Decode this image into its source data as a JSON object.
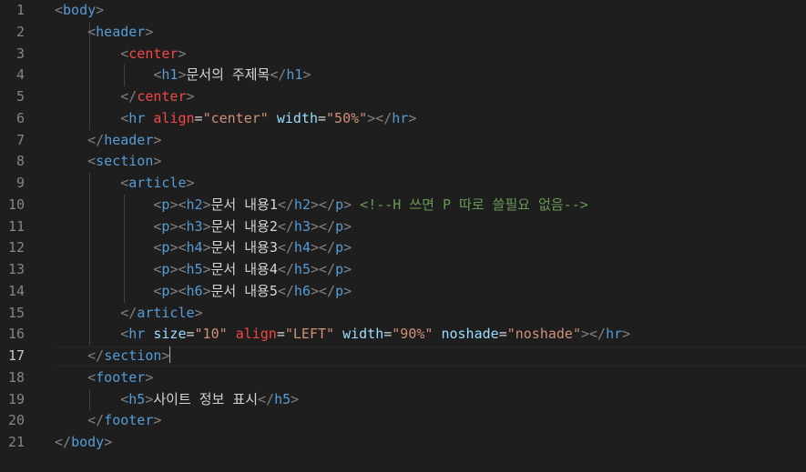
{
  "editor": {
    "active_line": 17,
    "lines": [
      {
        "num": "1",
        "tokens": [
          {
            "c": "t-punc",
            "t": "<"
          },
          {
            "c": "t-tag",
            "t": "body"
          },
          {
            "c": "t-punc",
            "t": ">"
          }
        ]
      },
      {
        "num": "2",
        "tokens": [
          {
            "c": "t-text",
            "t": "    "
          },
          {
            "c": "t-punc",
            "t": "<"
          },
          {
            "c": "t-tag",
            "t": "header"
          },
          {
            "c": "t-punc",
            "t": ">"
          }
        ]
      },
      {
        "num": "3",
        "tokens": [
          {
            "c": "t-text",
            "t": "        "
          },
          {
            "c": "t-punc",
            "t": "<"
          },
          {
            "c": "t-tag-red",
            "t": "center"
          },
          {
            "c": "t-punc",
            "t": ">"
          }
        ]
      },
      {
        "num": "4",
        "tokens": [
          {
            "c": "t-text",
            "t": "            "
          },
          {
            "c": "t-punc",
            "t": "<"
          },
          {
            "c": "t-tag",
            "t": "h1"
          },
          {
            "c": "t-punc",
            "t": ">"
          },
          {
            "c": "t-text",
            "t": "문서의 주제목"
          },
          {
            "c": "t-punc",
            "t": "</"
          },
          {
            "c": "t-tag",
            "t": "h1"
          },
          {
            "c": "t-punc",
            "t": ">"
          }
        ]
      },
      {
        "num": "5",
        "tokens": [
          {
            "c": "t-text",
            "t": "        "
          },
          {
            "c": "t-punc",
            "t": "</"
          },
          {
            "c": "t-tag-red",
            "t": "center"
          },
          {
            "c": "t-punc",
            "t": ">"
          }
        ]
      },
      {
        "num": "6",
        "tokens": [
          {
            "c": "t-text",
            "t": "        "
          },
          {
            "c": "t-punc",
            "t": "<"
          },
          {
            "c": "t-tag",
            "t": "hr"
          },
          {
            "c": "t-text",
            "t": " "
          },
          {
            "c": "t-tag-red",
            "t": "align"
          },
          {
            "c": "t-text",
            "t": "="
          },
          {
            "c": "t-str",
            "t": "\"center\""
          },
          {
            "c": "t-text",
            "t": " "
          },
          {
            "c": "t-attr",
            "t": "width"
          },
          {
            "c": "t-text",
            "t": "="
          },
          {
            "c": "t-str",
            "t": "\"50%\""
          },
          {
            "c": "t-punc",
            "t": "></"
          },
          {
            "c": "t-tag",
            "t": "hr"
          },
          {
            "c": "t-punc",
            "t": ">"
          }
        ]
      },
      {
        "num": "7",
        "tokens": [
          {
            "c": "t-text",
            "t": "    "
          },
          {
            "c": "t-punc",
            "t": "</"
          },
          {
            "c": "t-tag",
            "t": "header"
          },
          {
            "c": "t-punc",
            "t": ">"
          }
        ]
      },
      {
        "num": "8",
        "tokens": [
          {
            "c": "t-text",
            "t": "    "
          },
          {
            "c": "t-punc",
            "t": "<"
          },
          {
            "c": "t-tag",
            "t": "section"
          },
          {
            "c": "t-punc",
            "t": ">"
          }
        ]
      },
      {
        "num": "9",
        "tokens": [
          {
            "c": "t-text",
            "t": "        "
          },
          {
            "c": "t-punc",
            "t": "<"
          },
          {
            "c": "t-tag",
            "t": "article"
          },
          {
            "c": "t-punc",
            "t": ">"
          }
        ]
      },
      {
        "num": "10",
        "tokens": [
          {
            "c": "t-text",
            "t": "            "
          },
          {
            "c": "t-punc",
            "t": "<"
          },
          {
            "c": "t-tag",
            "t": "p"
          },
          {
            "c": "t-punc",
            "t": "><"
          },
          {
            "c": "t-tag",
            "t": "h2"
          },
          {
            "c": "t-punc",
            "t": ">"
          },
          {
            "c": "t-text",
            "t": "문서 내용1"
          },
          {
            "c": "t-punc",
            "t": "</"
          },
          {
            "c": "t-tag",
            "t": "h2"
          },
          {
            "c": "t-punc",
            "t": "></"
          },
          {
            "c": "t-tag",
            "t": "p"
          },
          {
            "c": "t-punc",
            "t": ">"
          },
          {
            "c": "t-text",
            "t": " "
          },
          {
            "c": "t-comment",
            "t": "<!--H 쓰면 P 따로 쓸필요 없음-->"
          }
        ]
      },
      {
        "num": "11",
        "tokens": [
          {
            "c": "t-text",
            "t": "            "
          },
          {
            "c": "t-punc",
            "t": "<"
          },
          {
            "c": "t-tag",
            "t": "p"
          },
          {
            "c": "t-punc",
            "t": "><"
          },
          {
            "c": "t-tag",
            "t": "h3"
          },
          {
            "c": "t-punc",
            "t": ">"
          },
          {
            "c": "t-text",
            "t": "문서 내용2"
          },
          {
            "c": "t-punc",
            "t": "</"
          },
          {
            "c": "t-tag",
            "t": "h3"
          },
          {
            "c": "t-punc",
            "t": "></"
          },
          {
            "c": "t-tag",
            "t": "p"
          },
          {
            "c": "t-punc",
            "t": ">"
          }
        ]
      },
      {
        "num": "12",
        "tokens": [
          {
            "c": "t-text",
            "t": "            "
          },
          {
            "c": "t-punc",
            "t": "<"
          },
          {
            "c": "t-tag",
            "t": "p"
          },
          {
            "c": "t-punc",
            "t": "><"
          },
          {
            "c": "t-tag",
            "t": "h4"
          },
          {
            "c": "t-punc",
            "t": ">"
          },
          {
            "c": "t-text",
            "t": "문서 내용3"
          },
          {
            "c": "t-punc",
            "t": "</"
          },
          {
            "c": "t-tag",
            "t": "h4"
          },
          {
            "c": "t-punc",
            "t": "></"
          },
          {
            "c": "t-tag",
            "t": "p"
          },
          {
            "c": "t-punc",
            "t": ">"
          }
        ]
      },
      {
        "num": "13",
        "tokens": [
          {
            "c": "t-text",
            "t": "            "
          },
          {
            "c": "t-punc",
            "t": "<"
          },
          {
            "c": "t-tag",
            "t": "p"
          },
          {
            "c": "t-punc",
            "t": "><"
          },
          {
            "c": "t-tag",
            "t": "h5"
          },
          {
            "c": "t-punc",
            "t": ">"
          },
          {
            "c": "t-text",
            "t": "문서 내용4"
          },
          {
            "c": "t-punc",
            "t": "</"
          },
          {
            "c": "t-tag",
            "t": "h5"
          },
          {
            "c": "t-punc",
            "t": "></"
          },
          {
            "c": "t-tag",
            "t": "p"
          },
          {
            "c": "t-punc",
            "t": ">"
          }
        ]
      },
      {
        "num": "14",
        "tokens": [
          {
            "c": "t-text",
            "t": "            "
          },
          {
            "c": "t-punc",
            "t": "<"
          },
          {
            "c": "t-tag",
            "t": "p"
          },
          {
            "c": "t-punc",
            "t": "><"
          },
          {
            "c": "t-tag",
            "t": "h6"
          },
          {
            "c": "t-punc",
            "t": ">"
          },
          {
            "c": "t-text",
            "t": "문서 내용5"
          },
          {
            "c": "t-punc",
            "t": "</"
          },
          {
            "c": "t-tag",
            "t": "h6"
          },
          {
            "c": "t-punc",
            "t": "></"
          },
          {
            "c": "t-tag",
            "t": "p"
          },
          {
            "c": "t-punc",
            "t": ">"
          }
        ]
      },
      {
        "num": "15",
        "tokens": [
          {
            "c": "t-text",
            "t": "        "
          },
          {
            "c": "t-punc",
            "t": "</"
          },
          {
            "c": "t-tag",
            "t": "article"
          },
          {
            "c": "t-punc",
            "t": ">"
          }
        ]
      },
      {
        "num": "16",
        "tokens": [
          {
            "c": "t-text",
            "t": "        "
          },
          {
            "c": "t-punc",
            "t": "<"
          },
          {
            "c": "t-tag",
            "t": "hr"
          },
          {
            "c": "t-text",
            "t": " "
          },
          {
            "c": "t-attr",
            "t": "size"
          },
          {
            "c": "t-text",
            "t": "="
          },
          {
            "c": "t-str",
            "t": "\"10\""
          },
          {
            "c": "t-text",
            "t": " "
          },
          {
            "c": "t-tag-red",
            "t": "align"
          },
          {
            "c": "t-text",
            "t": "="
          },
          {
            "c": "t-str",
            "t": "\"LEFT\""
          },
          {
            "c": "t-text",
            "t": " "
          },
          {
            "c": "t-attr",
            "t": "width"
          },
          {
            "c": "t-text",
            "t": "="
          },
          {
            "c": "t-str",
            "t": "\"90%\""
          },
          {
            "c": "t-text",
            "t": " "
          },
          {
            "c": "t-attr",
            "t": "noshade"
          },
          {
            "c": "t-text",
            "t": "="
          },
          {
            "c": "t-str",
            "t": "\"noshade\""
          },
          {
            "c": "t-punc",
            "t": "></"
          },
          {
            "c": "t-tag",
            "t": "hr"
          },
          {
            "c": "t-punc",
            "t": ">"
          }
        ]
      },
      {
        "num": "17",
        "tokens": [
          {
            "c": "t-text",
            "t": "    "
          },
          {
            "c": "t-punc",
            "t": "</"
          },
          {
            "c": "t-tag",
            "t": "section"
          },
          {
            "c": "t-punc",
            "t": ">"
          }
        ],
        "cursor": true
      },
      {
        "num": "18",
        "tokens": [
          {
            "c": "t-text",
            "t": "    "
          },
          {
            "c": "t-punc",
            "t": "<"
          },
          {
            "c": "t-tag",
            "t": "footer"
          },
          {
            "c": "t-punc",
            "t": ">"
          }
        ]
      },
      {
        "num": "19",
        "tokens": [
          {
            "c": "t-text",
            "t": "        "
          },
          {
            "c": "t-punc",
            "t": "<"
          },
          {
            "c": "t-tag",
            "t": "h5"
          },
          {
            "c": "t-punc",
            "t": ">"
          },
          {
            "c": "t-text",
            "t": "사이트 정보 표시"
          },
          {
            "c": "t-punc",
            "t": "</"
          },
          {
            "c": "t-tag",
            "t": "h5"
          },
          {
            "c": "t-punc",
            "t": ">"
          }
        ]
      },
      {
        "num": "20",
        "tokens": [
          {
            "c": "t-text",
            "t": "    "
          },
          {
            "c": "t-punc",
            "t": "</"
          },
          {
            "c": "t-tag",
            "t": "footer"
          },
          {
            "c": "t-punc",
            "t": ">"
          }
        ]
      },
      {
        "num": "21",
        "tokens": [
          {
            "c": "t-punc",
            "t": "</"
          },
          {
            "c": "t-tag",
            "t": "body"
          },
          {
            "c": "t-punc",
            "t": ">"
          }
        ]
      }
    ]
  }
}
